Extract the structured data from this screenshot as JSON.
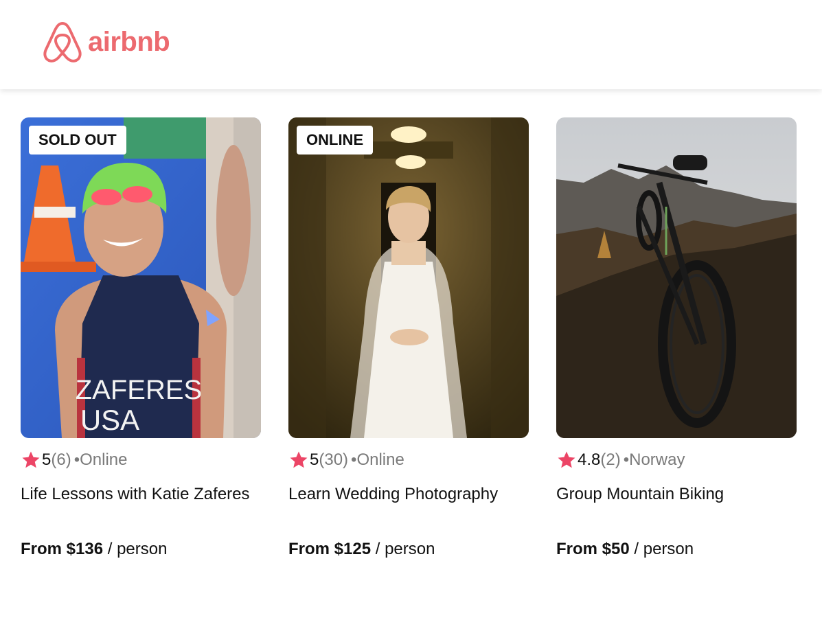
{
  "header": {
    "brand": "airbnb",
    "brand_color": "#ec6a6f"
  },
  "accent": {
    "star_color": "#ec4566"
  },
  "cards": [
    {
      "badge": "SOLD OUT",
      "photo": "triathlete-in-swimsuit",
      "rating": "5",
      "reviews": "(6)",
      "location": "•Online",
      "title": "Life Lessons with Katie Zaferes",
      "price": "From $136",
      "per": "/ person",
      "shirt_line1": "ZAFERES",
      "shirt_line2": "USA"
    },
    {
      "badge": "ONLINE",
      "photo": "bride-in-hallway",
      "rating": "5",
      "reviews": "(30)",
      "location": "•Online",
      "title": "Learn Wedding Photography",
      "price": "From $125",
      "per": "/ person"
    },
    {
      "badge": "",
      "photo": "mountain-bike-on-hillside",
      "rating": "4.8",
      "reviews": "(2)",
      "location": "•Norway",
      "title": "Group Mountain Biking",
      "price": "From $50",
      "per": "/ person"
    }
  ]
}
